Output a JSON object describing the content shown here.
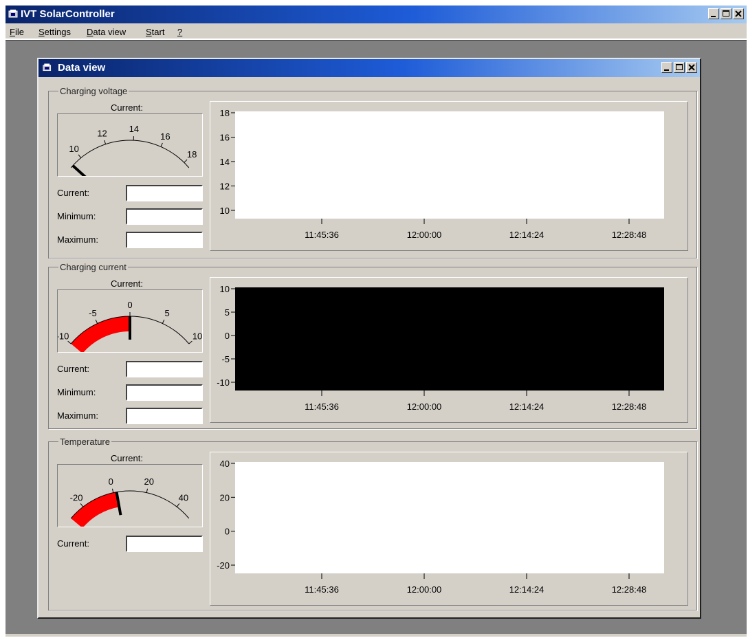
{
  "app": {
    "title": "IVT SolarController"
  },
  "menubar": {
    "items": [
      {
        "label": "File",
        "mnemonic": "F",
        "rest": "ile"
      },
      {
        "label": "Settings",
        "mnemonic": "S",
        "rest": "ettings"
      },
      {
        "label": "Data view",
        "mnemonic": "D",
        "rest": "ata view"
      },
      {
        "label": "Start",
        "mnemonic": "S",
        "rest": "tart"
      },
      {
        "label": "?",
        "mnemonic": "?",
        "rest": ""
      }
    ]
  },
  "dataview": {
    "title": "Data view",
    "panels": [
      {
        "label": "Charging voltage",
        "gauge_label": "Current:",
        "gauge_ticks": [
          "10",
          "12",
          "14",
          "16",
          "18"
        ],
        "gauge_min": 9,
        "gauge_max": 18.5,
        "needle_value": 9.2,
        "fill_value": null,
        "fields": [
          {
            "label": "Current:",
            "value": ""
          },
          {
            "label": "Minimum:",
            "value": ""
          },
          {
            "label": "Maximum:",
            "value": ""
          }
        ],
        "chart": {
          "background": "#ffffff",
          "y_ticks": [
            "18",
            "16",
            "14",
            "12",
            "10"
          ],
          "x_ticks": [
            "11:45:36",
            "12:00:00",
            "12:14:24",
            "12:28:48"
          ]
        }
      },
      {
        "label": "Charging current",
        "gauge_label": "Current:",
        "gauge_ticks": [
          "-10",
          "-5",
          "0",
          "5",
          "10"
        ],
        "gauge_min": -10,
        "gauge_max": 10,
        "needle_value": 0,
        "fill_value": -10,
        "fields": [
          {
            "label": "Current:",
            "value": ""
          },
          {
            "label": "Minimum:",
            "value": ""
          },
          {
            "label": "Maximum:",
            "value": ""
          }
        ],
        "chart": {
          "background": "#000000",
          "y_ticks": [
            "10",
            "5",
            "0",
            "-5",
            "-10"
          ],
          "x_ticks": [
            "11:45:36",
            "12:00:00",
            "12:14:24",
            "12:28:48"
          ]
        }
      },
      {
        "label": "Temperature",
        "gauge_label": "Current:",
        "gauge_ticks": [
          "-20",
          "0",
          "20",
          "40"
        ],
        "gauge_min": -30,
        "gauge_max": 50,
        "needle_value": 2,
        "fill_value": -30,
        "fields": [
          {
            "label": "Current:",
            "value": ""
          }
        ],
        "chart": {
          "background": "#ffffff",
          "y_ticks": [
            "40",
            "20",
            "0",
            "-20"
          ],
          "x_ticks": [
            "11:45:36",
            "12:00:00",
            "12:14:24",
            "12:28:48"
          ]
        }
      }
    ]
  },
  "colors": {
    "titlebar_start": "#0a246a",
    "titlebar_end": "#a6caf0",
    "gauge_fill": "#ff0000",
    "face": "#d4d0c8"
  }
}
